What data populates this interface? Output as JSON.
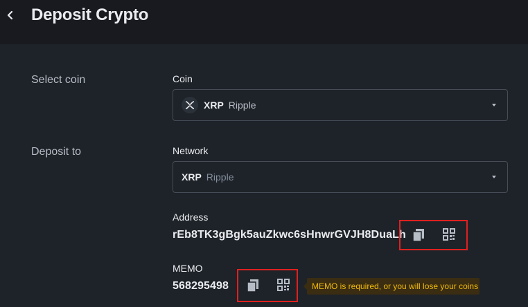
{
  "header": {
    "title": "Deposit Crypto"
  },
  "select_coin": {
    "section_label": "Select coin",
    "field_label": "Coin",
    "symbol": "XRP",
    "name": "Ripple"
  },
  "deposit_to": {
    "section_label": "Deposit to",
    "network_label": "Network",
    "network_symbol": "XRP",
    "network_name": "Ripple"
  },
  "address": {
    "label": "Address",
    "value": "rEb8TK3gBgk5auZkwc6sHnwrGVJH8DuaLh"
  },
  "memo": {
    "label": "MEMO",
    "value": "568295498",
    "warning": "MEMO is required, or you will lose your coins"
  },
  "icons": [
    "chevron-left-icon",
    "xrp-logo-icon",
    "copy-icon",
    "qr-code-icon"
  ],
  "colors": {
    "background": "#1e2329",
    "header": "#181a20",
    "highlight": "#e02020",
    "warning_text": "#f0b90b"
  }
}
